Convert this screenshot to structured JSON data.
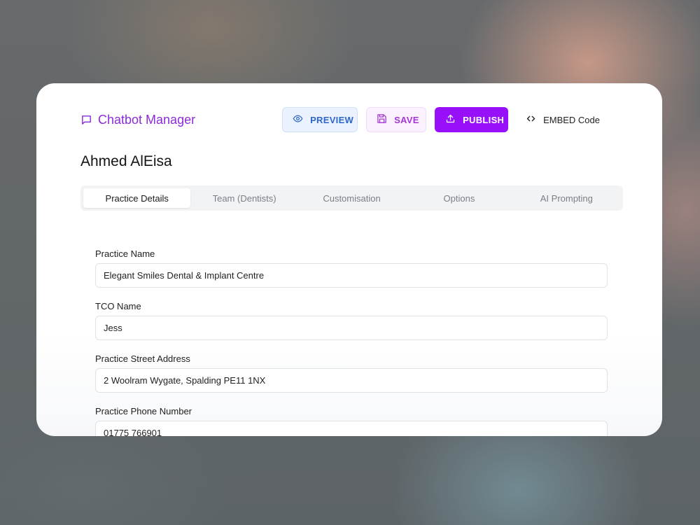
{
  "app": {
    "title": "Chatbot Manager",
    "accent": "#9810fa",
    "icon": "chat-bubble-icon"
  },
  "toolbar": {
    "preview_label": "PREVIEW",
    "preview_icon": "eye-icon",
    "save_label": "SAVE",
    "save_icon": "floppy-disk-icon",
    "publish_label": "PUBLISH",
    "publish_icon": "upload-icon",
    "embed_label": "EMBED Code",
    "embed_icon": "code-brackets-icon"
  },
  "page": {
    "title": "Ahmed AlEisa"
  },
  "tabs": [
    {
      "label": "Practice Details",
      "active": true
    },
    {
      "label": "Team (Dentists)",
      "active": false
    },
    {
      "label": "Customisation",
      "active": false
    },
    {
      "label": "Options",
      "active": false
    },
    {
      "label": "AI Prompting",
      "active": false
    }
  ],
  "form": {
    "fields": [
      {
        "label": "Practice Name",
        "value": "Elegant Smiles Dental & Implant Centre"
      },
      {
        "label": "TCO Name",
        "value": "Jess"
      },
      {
        "label": "Practice Street Address",
        "value": "2 Woolram Wygate, Spalding PE11 1NX"
      },
      {
        "label": "Practice Phone Number",
        "value": "01775 766901"
      }
    ]
  }
}
